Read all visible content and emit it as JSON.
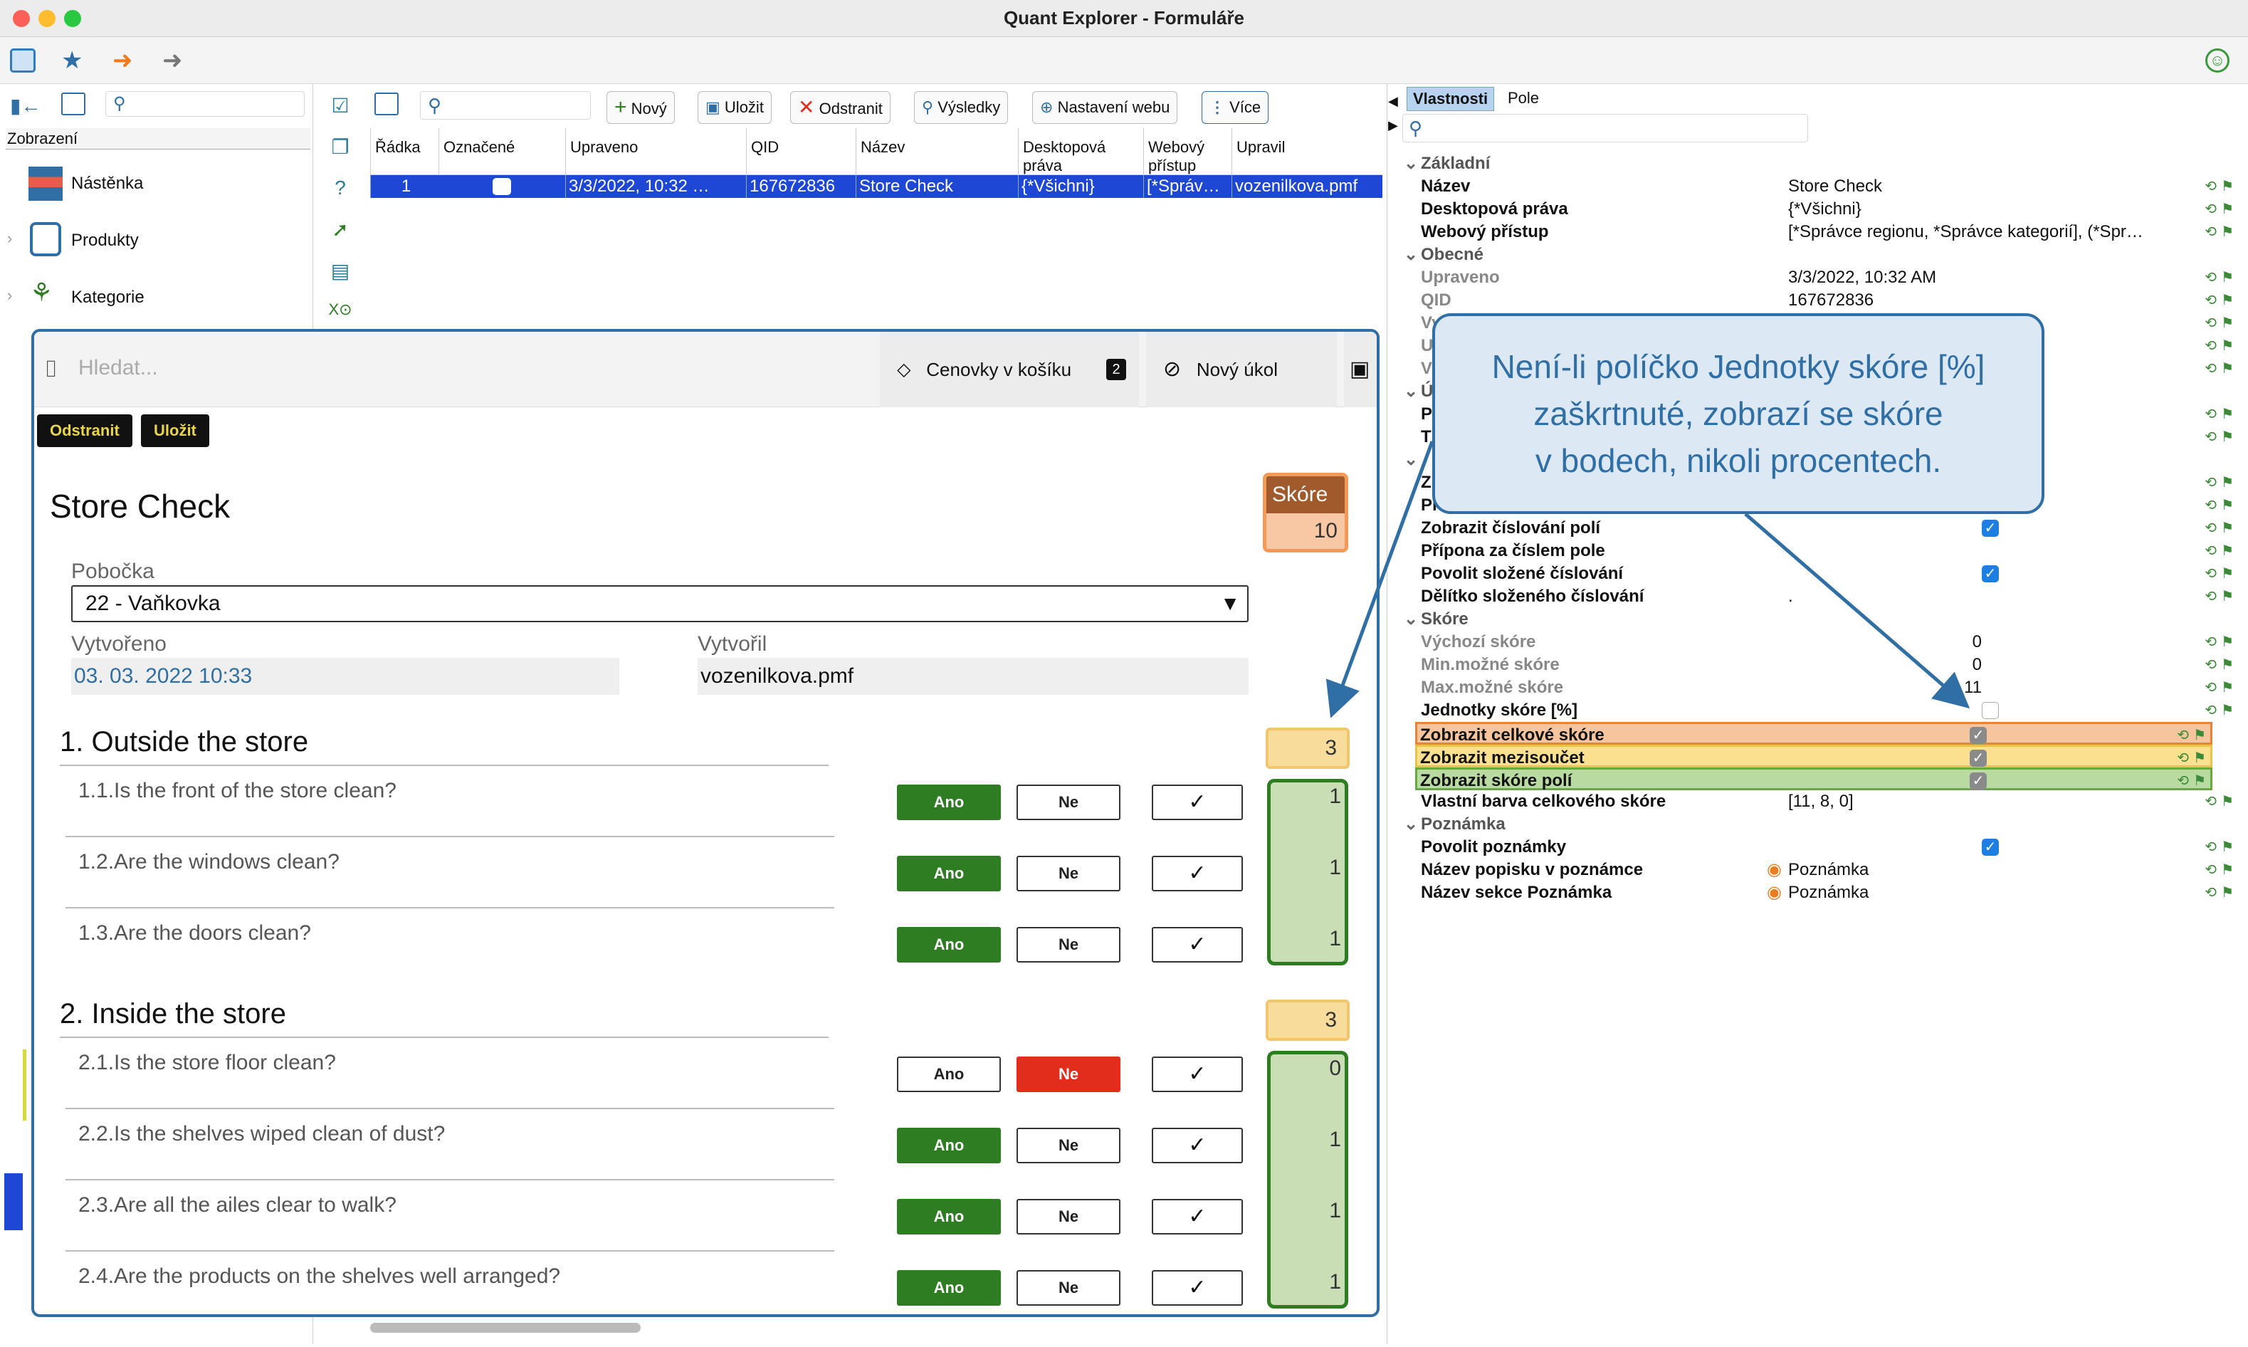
{
  "window": {
    "title": "Quant Explorer - Formuláře"
  },
  "left": {
    "section_label": "Zobrazení",
    "items": [
      {
        "label": "Nástěnka"
      },
      {
        "label": "Produkty"
      },
      {
        "label": "Kategorie"
      }
    ]
  },
  "toolbar": {
    "new": "Nový",
    "save": "Uložit",
    "delete": "Odstranit",
    "results": "Výsledky",
    "web": "Nastavení webu",
    "more": "Více"
  },
  "grid": {
    "headers": [
      "Řádka",
      "Označené",
      "Upraveno",
      "QID",
      "Název",
      "Desktopová práva",
      "Webový přístup",
      "Upravil"
    ],
    "row": {
      "line": "1",
      "modified": "3/3/2022, 10:32 …",
      "qid": "167672836",
      "name": "Store Check",
      "desktop": "{*Všichni}",
      "web": "[*Správ…",
      "by": "vozenilkova.pmf"
    }
  },
  "form": {
    "search_placeholder": "Hledat...",
    "cart_label": "Cenovky v košíku",
    "cart_count": "2",
    "task_label": "Nový úkol",
    "delete": "Odstranit",
    "save": "Uložit",
    "title": "Store Check",
    "score_label": "Skóre",
    "score_value": "10",
    "branch_label": "Pobočka",
    "branch_value": "22 - Vaňkovka",
    "created_label": "Vytvořeno",
    "created_value": "03. 03. 2022 10:33",
    "creator_label": "Vytvořil",
    "creator_value": "vozenilkova.pmf",
    "yes": "Ano",
    "no": "Ne",
    "sections": [
      {
        "title": "1. Outside the store",
        "score": "3",
        "questions": [
          {
            "text": "1.1.Is the front of the store clean?",
            "answer": "yes",
            "score": "1"
          },
          {
            "text": "1.2.Are the windows clean?",
            "answer": "yes",
            "score": "1"
          },
          {
            "text": "1.3.Are the doors clean?",
            "answer": "yes",
            "score": "1"
          }
        ]
      },
      {
        "title": "2. Inside the store",
        "score": "3",
        "questions": [
          {
            "text": "2.1.Is the store floor clean?",
            "answer": "no",
            "score": "0"
          },
          {
            "text": "2.2.Is the shelves wiped clean of dust?",
            "answer": "yes",
            "score": "1"
          },
          {
            "text": "2.3.Are all the ailes clear to walk?",
            "answer": "yes",
            "score": "1"
          },
          {
            "text": "2.4.Are the products on the shelves well arranged?",
            "answer": "yes",
            "score": "1"
          }
        ]
      }
    ]
  },
  "props": {
    "tab_properties": "Vlastnosti",
    "tab_fields": "Pole",
    "rows": [
      {
        "g": "Základní"
      },
      {
        "k": "Název",
        "v": "Store Check"
      },
      {
        "k": "Desktopová práva",
        "v": "{*Všichni}"
      },
      {
        "k": "Webový přístup",
        "v": "[*Správce regionu, *Správce kategorií], (*Spr…"
      },
      {
        "g": "Obecné"
      },
      {
        "k": "Upraveno",
        "v": "3/3/2022, 10:32 AM",
        "grey": true
      },
      {
        "k": "QID",
        "v": "167672836",
        "grey": true
      },
      {
        "k": "Vy",
        "v": "",
        "grey": true
      },
      {
        "k": "U",
        "v": "",
        "grey": true
      },
      {
        "k": "V",
        "v": "",
        "grey": true
      },
      {
        "g": "Ú"
      },
      {
        "k": "P",
        "v": ""
      },
      {
        "k": "T",
        "v": ""
      },
      {
        "g": ""
      },
      {
        "k": "Z",
        "v": ""
      },
      {
        "k": "Př",
        "v": ""
      },
      {
        "k": "Zobrazit číslování polí",
        "c": "on"
      },
      {
        "k": "Přípona za číslem pole",
        "v": ""
      },
      {
        "k": "Povolit složené číslování",
        "c": "on"
      },
      {
        "k": "Dělítko složeného číslování",
        "v": "."
      },
      {
        "g": "Skóre"
      },
      {
        "k": "Výchozí skóre",
        "v": "0",
        "grey": true,
        "num": true
      },
      {
        "k": "Min.možné skóre",
        "v": "0",
        "grey": true,
        "num": true
      },
      {
        "k": "Max.možné skóre",
        "v": "11",
        "grey": true,
        "num": true
      },
      {
        "k": "Jednotky skóre [%]",
        "c": "off"
      },
      {
        "k": "Zobrazit celkové skóre",
        "c": "grey",
        "hl": "orange"
      },
      {
        "k": "Zobrazit mezisoučet",
        "c": "grey",
        "hl": "yellow"
      },
      {
        "k": "Zobrazit skóre polí",
        "c": "grey",
        "hl": "green"
      },
      {
        "k": "Vlastní barva celkového skóre",
        "v": "[11, 8, 0]"
      },
      {
        "g": "Poznámka"
      },
      {
        "k": "Povolit poznámky",
        "c": "on"
      },
      {
        "k": "Název popisku v poznámce",
        "v": "Poznámka",
        "dot": true
      },
      {
        "k": "Název sekce Poznámka",
        "v": "Poznámka",
        "dot": true
      }
    ]
  },
  "callout": {
    "lines": [
      "Není-li políčko Jednotky skóre [%]",
      "zaškrtnuté, zobrazí se skóre",
      "v bodech, nikoli procentech."
    ]
  },
  "colors": {
    "accent": "#2f6fa5",
    "yes": "#2e7d22",
    "no": "#e22d1d",
    "row_select": "#1e47d6"
  }
}
